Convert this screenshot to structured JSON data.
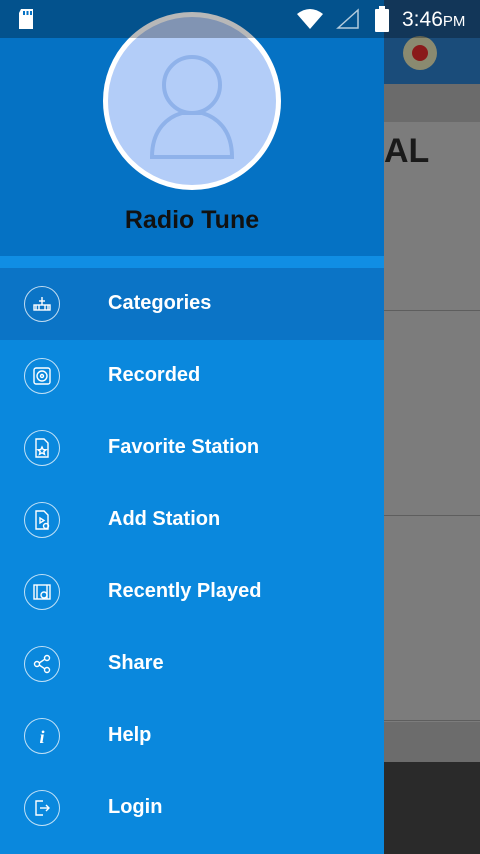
{
  "status_bar": {
    "time": "3:46",
    "ampm": "PM"
  },
  "background_app": {
    "heading_fragment": "AL"
  },
  "drawer": {
    "app_name": "Radio Tune",
    "menu": [
      {
        "label": "Categories",
        "icon": "radio-tower-icon",
        "active": true
      },
      {
        "label": "Recorded",
        "icon": "record-disc-icon",
        "active": false
      },
      {
        "label": "Favorite Station",
        "icon": "favorite-file-icon",
        "active": false
      },
      {
        "label": "Add Station",
        "icon": "add-media-file-icon",
        "active": false
      },
      {
        "label": "Recently Played",
        "icon": "history-film-icon",
        "active": false
      },
      {
        "label": "Share",
        "icon": "share-icon",
        "active": false
      },
      {
        "label": "Help",
        "icon": "info-icon",
        "active": false
      },
      {
        "label": "Login",
        "icon": "login-icon",
        "active": false
      }
    ]
  },
  "colors": {
    "drawer_header": "#0572c4",
    "drawer_body": "#0a88dd",
    "active_item": "#0b74c6",
    "avatar_fill": "#b3cdf8"
  }
}
